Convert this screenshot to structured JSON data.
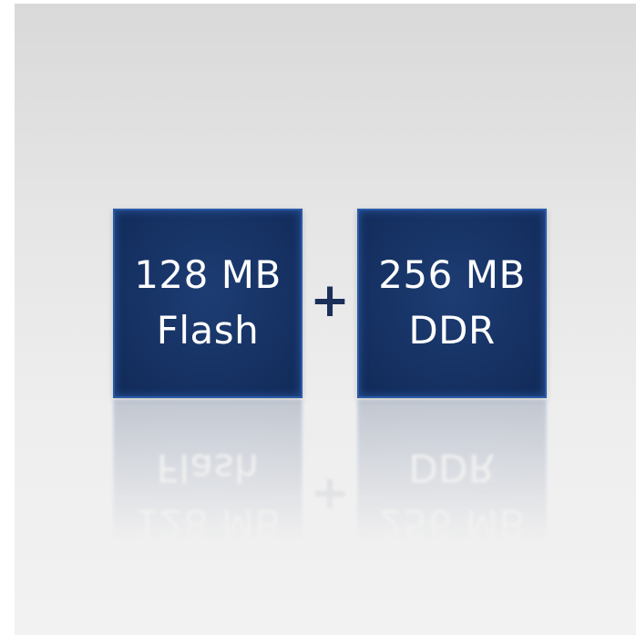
{
  "flash_chip": {
    "line1": "128 MB",
    "line2": "Flash"
  },
  "operator": "+",
  "ddr_chip": {
    "line1": "256 MB",
    "line2": "DDR"
  },
  "colors": {
    "chip_fill": "#163163",
    "chip_border": "#2a5aa8",
    "plus_color": "#1b2f59",
    "background_top": "#d9d9d9",
    "background_bottom": "#f2f2f2"
  }
}
